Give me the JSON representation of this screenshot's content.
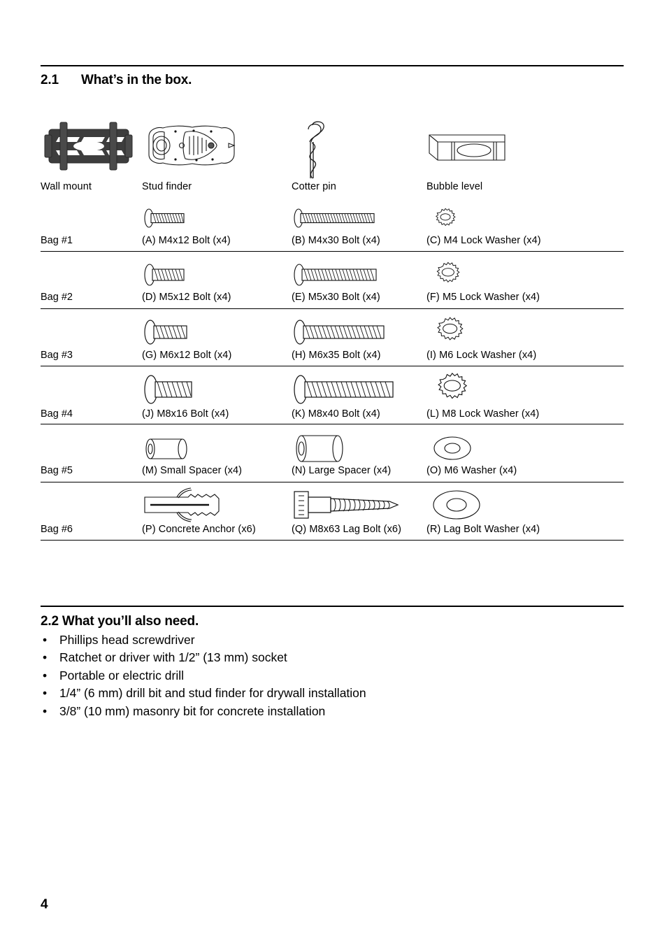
{
  "page_number": "4",
  "sections": {
    "box": {
      "number": "2.1",
      "title": "What’s in the box."
    },
    "needs": {
      "heading": "2.2 What you’ll also need."
    }
  },
  "tools": [
    {
      "label": "Wall mount",
      "icon": "wall-mount-bracket-icon"
    },
    {
      "label": "Stud finder",
      "icon": "stud-finder-icon"
    },
    {
      "label": "Cotter pin",
      "icon": "cotter-pin-icon"
    },
    {
      "label": "Bubble level",
      "icon": "bubble-level-icon"
    }
  ],
  "bags": [
    {
      "bag_label": "Bag #1",
      "parts": [
        {
          "label": "(A) M4x12 Bolt (x4)",
          "icon": "bolt-icon"
        },
        {
          "label": "(B) M4x30 Bolt (x4)",
          "icon": "bolt-icon"
        },
        {
          "label": "(C) M4 Lock Washer (x4)",
          "icon": "lock-washer-icon"
        }
      ]
    },
    {
      "bag_label": "Bag #2",
      "parts": [
        {
          "label": "(D) M5x12 Bolt (x4)",
          "icon": "bolt-icon"
        },
        {
          "label": "(E) M5x30 Bolt (x4)",
          "icon": "bolt-icon"
        },
        {
          "label": "(F) M5 Lock Washer (x4)",
          "icon": "lock-washer-icon"
        }
      ]
    },
    {
      "bag_label": "Bag #3",
      "parts": [
        {
          "label": "(G) M6x12 Bolt (x4)",
          "icon": "bolt-icon"
        },
        {
          "label": "(H) M6x35 Bolt (x4)",
          "icon": "bolt-icon"
        },
        {
          "label": "(I) M6 Lock Washer (x4)",
          "icon": "lock-washer-icon"
        }
      ]
    },
    {
      "bag_label": "Bag #4",
      "parts": [
        {
          "label": "(J) M8x16 Bolt (x4)",
          "icon": "bolt-icon"
        },
        {
          "label": "(K) M8x40 Bolt (x4)",
          "icon": "bolt-icon"
        },
        {
          "label": "(L) M8 Lock Washer (x4)",
          "icon": "lock-washer-icon"
        }
      ]
    },
    {
      "bag_label": "Bag #5",
      "parts": [
        {
          "label": "(M) Small Spacer (x4)",
          "icon": "spacer-cylinder-icon"
        },
        {
          "label": "(N) Large Spacer (x4)",
          "icon": "spacer-cylinder-icon"
        },
        {
          "label": "(O) M6 Washer (x4)",
          "icon": "flat-washer-icon"
        }
      ]
    },
    {
      "bag_label": "Bag #6",
      "parts": [
        {
          "label": "(P) Concrete Anchor (x6)",
          "icon": "concrete-anchor-icon"
        },
        {
          "label": "(Q) M8x63 Lag Bolt (x6)",
          "icon": "lag-bolt-icon"
        },
        {
          "label": "(R) Lag Bolt Washer (x4)",
          "icon": "flat-washer-icon"
        }
      ]
    }
  ],
  "needed_items": [
    "Phillips head screwdriver",
    "Ratchet or driver with 1/2” (13 mm) socket",
    "Portable or electric drill",
    "1/4” (6 mm) drill bit and stud finder for drywall installation",
    "3/8” (10 mm) masonry bit for concrete installation"
  ],
  "bullet_glyph": "•",
  "colors": {
    "ink": "#000000",
    "paper": "#ffffff",
    "metal_dark": "#3a3a3a"
  }
}
